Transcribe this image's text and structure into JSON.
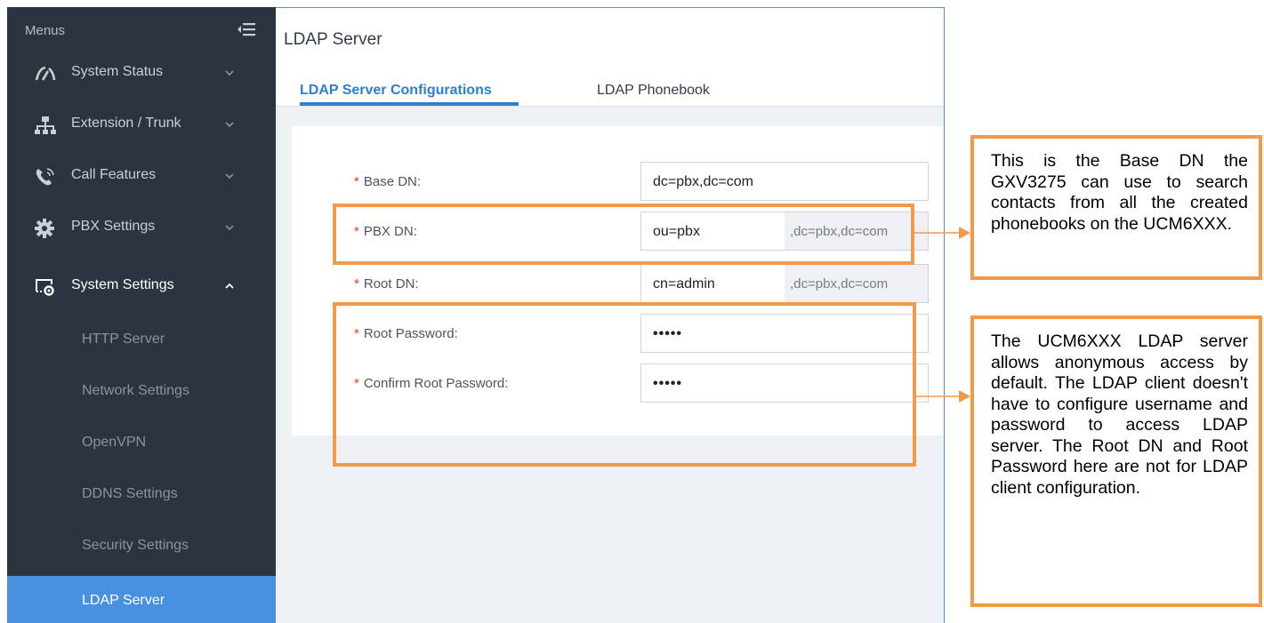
{
  "sidebar": {
    "title": "Menus",
    "items": [
      {
        "label": "System Status",
        "icon": "gauge-icon"
      },
      {
        "label": "Extension / Trunk",
        "icon": "network-icon"
      },
      {
        "label": "Call Features",
        "icon": "phone-call-icon"
      },
      {
        "label": "PBX Settings",
        "icon": "gear-icon"
      },
      {
        "label": "System Settings",
        "icon": "system-settings-icon"
      }
    ],
    "subitems": [
      {
        "label": "HTTP Server"
      },
      {
        "label": "Network Settings"
      },
      {
        "label": "OpenVPN"
      },
      {
        "label": "DDNS Settings"
      },
      {
        "label": "Security Settings"
      },
      {
        "label": "LDAP Server"
      }
    ],
    "active_subitem": "LDAP Server"
  },
  "main": {
    "title": "LDAP Server",
    "tabs": [
      {
        "label": "LDAP Server Configurations",
        "active": true
      },
      {
        "label": "LDAP Phonebook",
        "active": false
      }
    ],
    "form": {
      "required_mark": "*",
      "fields": [
        {
          "label": "Base DN:",
          "value": "dc=pbx,dc=com",
          "suffix": ""
        },
        {
          "label": "PBX DN:",
          "value": "ou=pbx",
          "suffix": ",dc=pbx,dc=com"
        },
        {
          "label": "Root DN:",
          "value": "cn=admin",
          "suffix": ",dc=pbx,dc=com"
        },
        {
          "label": "Root Password:",
          "value": "•••••",
          "suffix": ""
        },
        {
          "label": "Confirm Root Password:",
          "value": "•••••",
          "suffix": ""
        }
      ]
    }
  },
  "annotations": {
    "note_1": "This is the Base DN the GXV3275 can use to search contacts from all the created phonebooks on the UCM6XXX.",
    "note_2": "The UCM6XXX LDAP server allows anonymous access by default. The LDAP client doesn't have to configure username and password to access LDAP server. The Root DN and Root Password here are not for LDAP client configuration.",
    "color": "#f29a4a"
  },
  "colors": {
    "sidebar_bg": "#2c3440",
    "active_item_bg": "#4a90e2",
    "tab_accent": "#2c80d0",
    "required_mark": "#e2401b"
  }
}
